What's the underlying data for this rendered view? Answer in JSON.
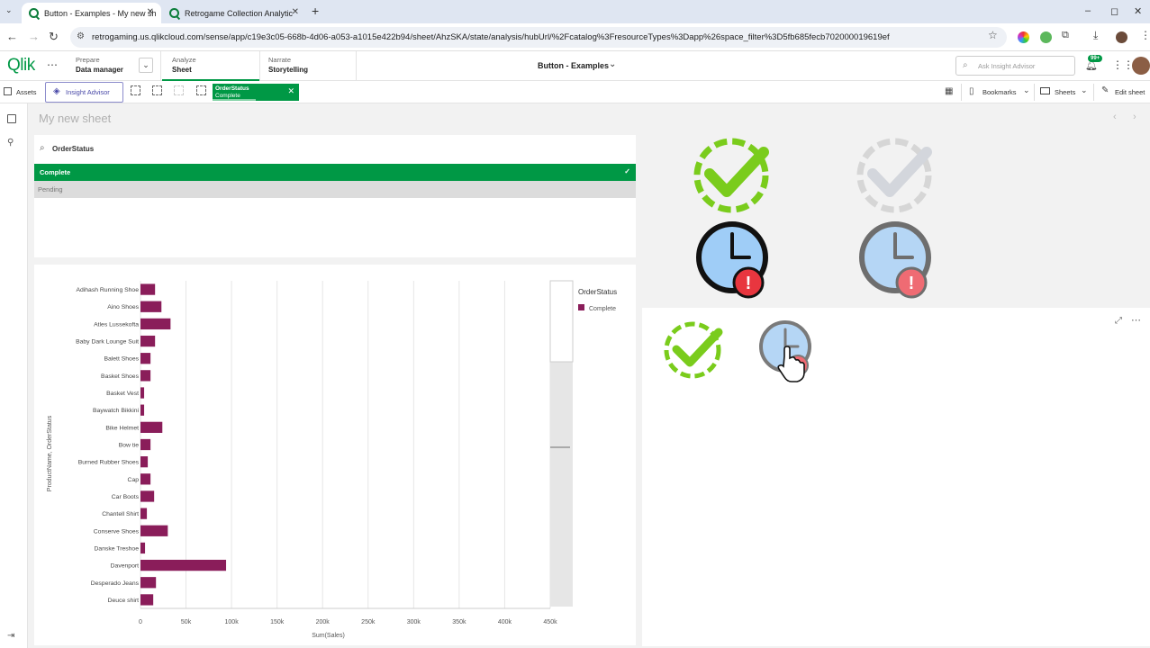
{
  "browser": {
    "tabs": [
      {
        "title": "Button - Examples - My new sh",
        "active": true
      },
      {
        "title": "Retrogame Collection Analytic",
        "active": false
      }
    ],
    "new_tab": "+",
    "url": "retrogaming.us.qlikcloud.com/sense/app/c19e3c05-668b-4d06-a053-a1015e422b94/sheet/AhzSKA/state/analysis/hubUrl/%2Fcatalog%3FresourceTypes%3Dapp%26space_filter%3D5fb685fecb702000019619ef",
    "window_controls": [
      "–",
      "◻",
      "✕"
    ]
  },
  "qlik": {
    "logo": "Qlik",
    "nav": [
      {
        "small": "Prepare",
        "label": "Data manager"
      },
      {
        "small": "Analyze",
        "label": "Sheet"
      },
      {
        "small": "Narrate",
        "label": "Storytelling"
      }
    ],
    "app_title": "Button - Examples",
    "search_placeholder": "Ask Insight Advisor",
    "notif_badge": "99+"
  },
  "toolbar": {
    "assets": "Assets",
    "insight_advisor": "Insight Advisor",
    "chip_field": "OrderStatus",
    "chip_value": "Complete",
    "bookmarks": "Bookmarks",
    "sheets": "Sheets",
    "edit_sheet": "Edit sheet"
  },
  "sheet": {
    "title": "My new sheet"
  },
  "filter": {
    "field": "OrderStatus",
    "selected": "Complete",
    "other": "Pending"
  },
  "chart_data": {
    "type": "bar",
    "orientation": "horizontal",
    "xlabel": "Sum(Sales)",
    "ylabel": "ProductName, OrderStatus",
    "x_ticks": [
      "0",
      "50k",
      "100k",
      "150k",
      "200k",
      "250k",
      "300k",
      "350k",
      "400k",
      "450k"
    ],
    "xlim": [
      0,
      450000
    ],
    "legend_title": "OrderStatus",
    "legend_position": "top-right",
    "grid": true,
    "series": [
      {
        "name": "Complete",
        "color": "#8a1d5a"
      }
    ],
    "categories": [
      "Adihash Running Shoe",
      "Aino Shoes",
      "Atles Lussekofta",
      "Baby Dark Lounge Suit",
      "Balett Shoes",
      "Basket Shoes",
      "Basket Vest",
      "Baywatch Bikkini",
      "Bike Helmet",
      "Bow tie",
      "Burned Rubber Shoes",
      "Cap",
      "Car Boots",
      "Chantell Shirt",
      "Conserve Shoes",
      "Danske Treshoe",
      "Davenport",
      "Desperado Jeans",
      "Deuce shirt"
    ],
    "values": [
      16000,
      23000,
      33000,
      16000,
      11000,
      11000,
      4000,
      4000,
      24000,
      11000,
      8000,
      11000,
      15000,
      7000,
      30000,
      5000,
      94000,
      17000,
      14000
    ]
  },
  "icons": {
    "accent_green": "#009845",
    "check_green": "#7acc1c",
    "clock_blue": "#9fcdf7",
    "alert_red": "#e8363f"
  }
}
